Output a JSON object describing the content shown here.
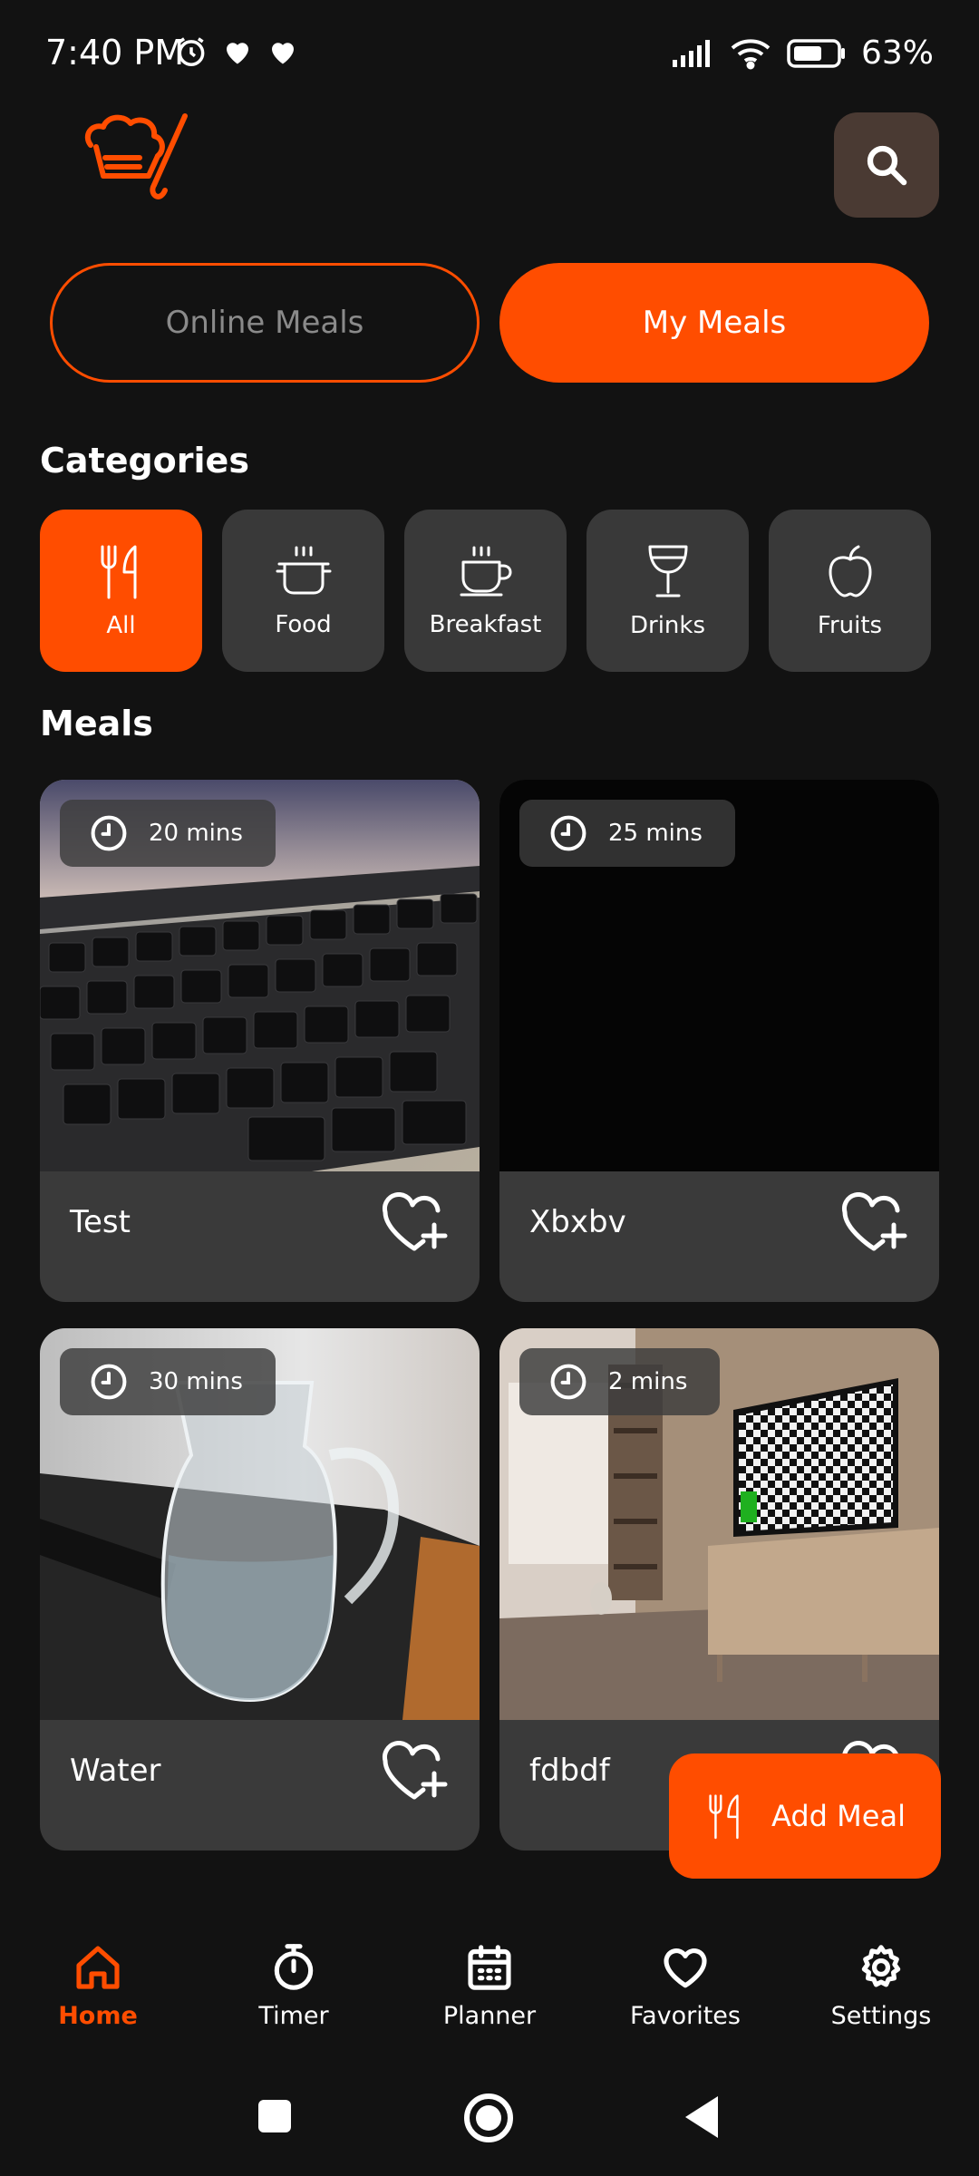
{
  "status": {
    "time": "7:40 PM",
    "battery": "63%"
  },
  "header": {
    "logo": "chef-hat-logo",
    "search_icon": "search-icon"
  },
  "toggle": {
    "online_label": "Online Meals",
    "my_label": "My Meals",
    "selected": "My Meals"
  },
  "categories": {
    "title": "Categories",
    "items": [
      {
        "label": "All",
        "icon": "utensils-icon",
        "active": true
      },
      {
        "label": "Food",
        "icon": "pot-icon",
        "active": false
      },
      {
        "label": "Breakfast",
        "icon": "coffee-cup-icon",
        "active": false
      },
      {
        "label": "Drinks",
        "icon": "wine-glass-icon",
        "active": false
      },
      {
        "label": "Fruits",
        "icon": "apple-icon",
        "active": false
      }
    ]
  },
  "meals": {
    "title": "Meals",
    "items": [
      {
        "name": "Test",
        "time": "20 mins"
      },
      {
        "name": "Xbxbv",
        "time": "25 mins"
      },
      {
        "name": "Water",
        "time": "30 mins"
      },
      {
        "name": "fdbdf",
        "time": "2 mins"
      }
    ]
  },
  "fab": {
    "label": "Add Meal"
  },
  "nav": {
    "items": [
      {
        "label": "Home",
        "icon": "home-icon",
        "active": true
      },
      {
        "label": "Timer",
        "icon": "stopwatch-icon",
        "active": false
      },
      {
        "label": "Planner",
        "icon": "calendar-icon",
        "active": false
      },
      {
        "label": "Favorites",
        "icon": "heart-icon",
        "active": false
      },
      {
        "label": "Settings",
        "icon": "gear-icon",
        "active": false
      }
    ]
  },
  "colors": {
    "accent": "#ff4d00",
    "background": "#121212",
    "card": "#3a3a3a",
    "search_bg": "#4a3a33"
  }
}
